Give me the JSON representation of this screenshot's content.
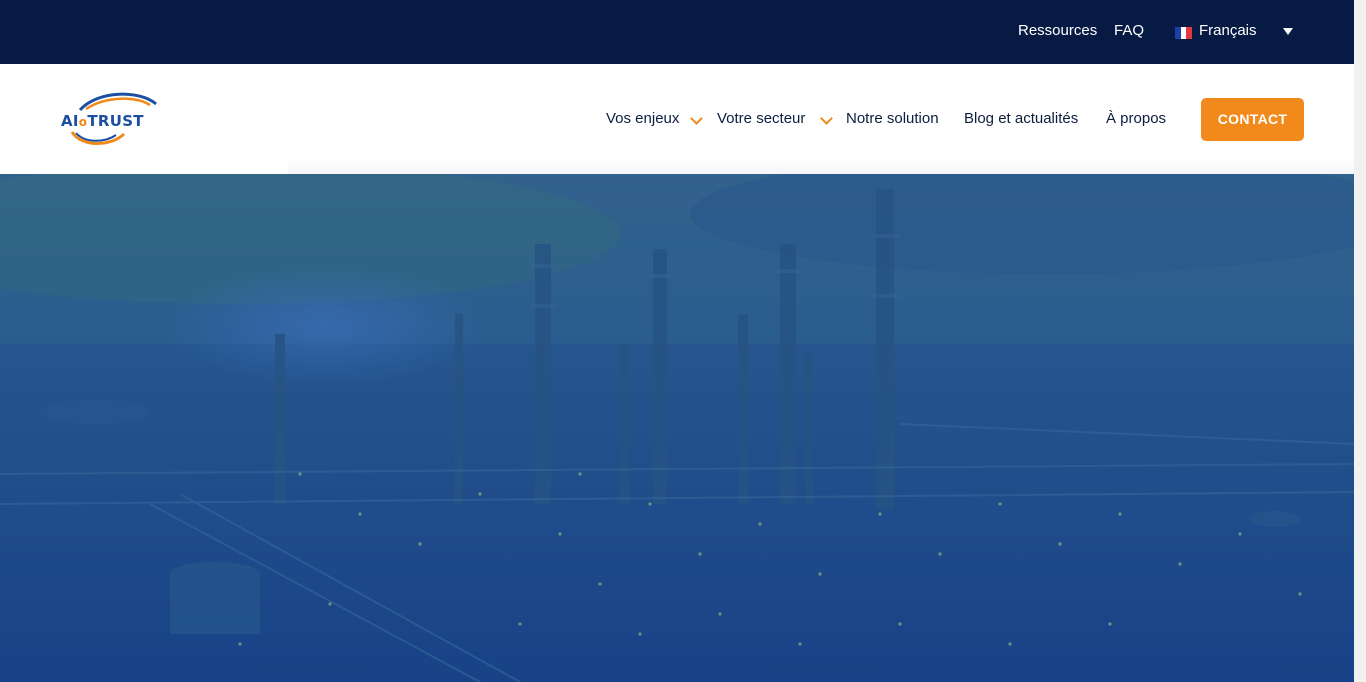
{
  "topbar": {
    "links": [
      "Ressources",
      "FAQ"
    ],
    "language": {
      "label": "Français",
      "flag": "france-flag-icon"
    }
  },
  "header": {
    "logo": {
      "text_left": "AI",
      "text_mid": "o",
      "text_right": "TRUST"
    },
    "nav": [
      {
        "label": "Vos enjeux",
        "has_dropdown": true
      },
      {
        "label": "Votre secteur",
        "has_dropdown": true
      },
      {
        "label": "Notre solution",
        "has_dropdown": false
      },
      {
        "label": "Blog et actualités",
        "has_dropdown": false
      },
      {
        "label": "À propos",
        "has_dropdown": false
      }
    ],
    "contact_label": "CONTACT"
  },
  "colors": {
    "topbar_bg": "#071a44",
    "accent": "#f28a1b",
    "brand_blue": "#1c4fa1",
    "hero_overlay": "#1d4d8d"
  },
  "hero": {
    "image": "industrial-refinery-at-dusk"
  }
}
